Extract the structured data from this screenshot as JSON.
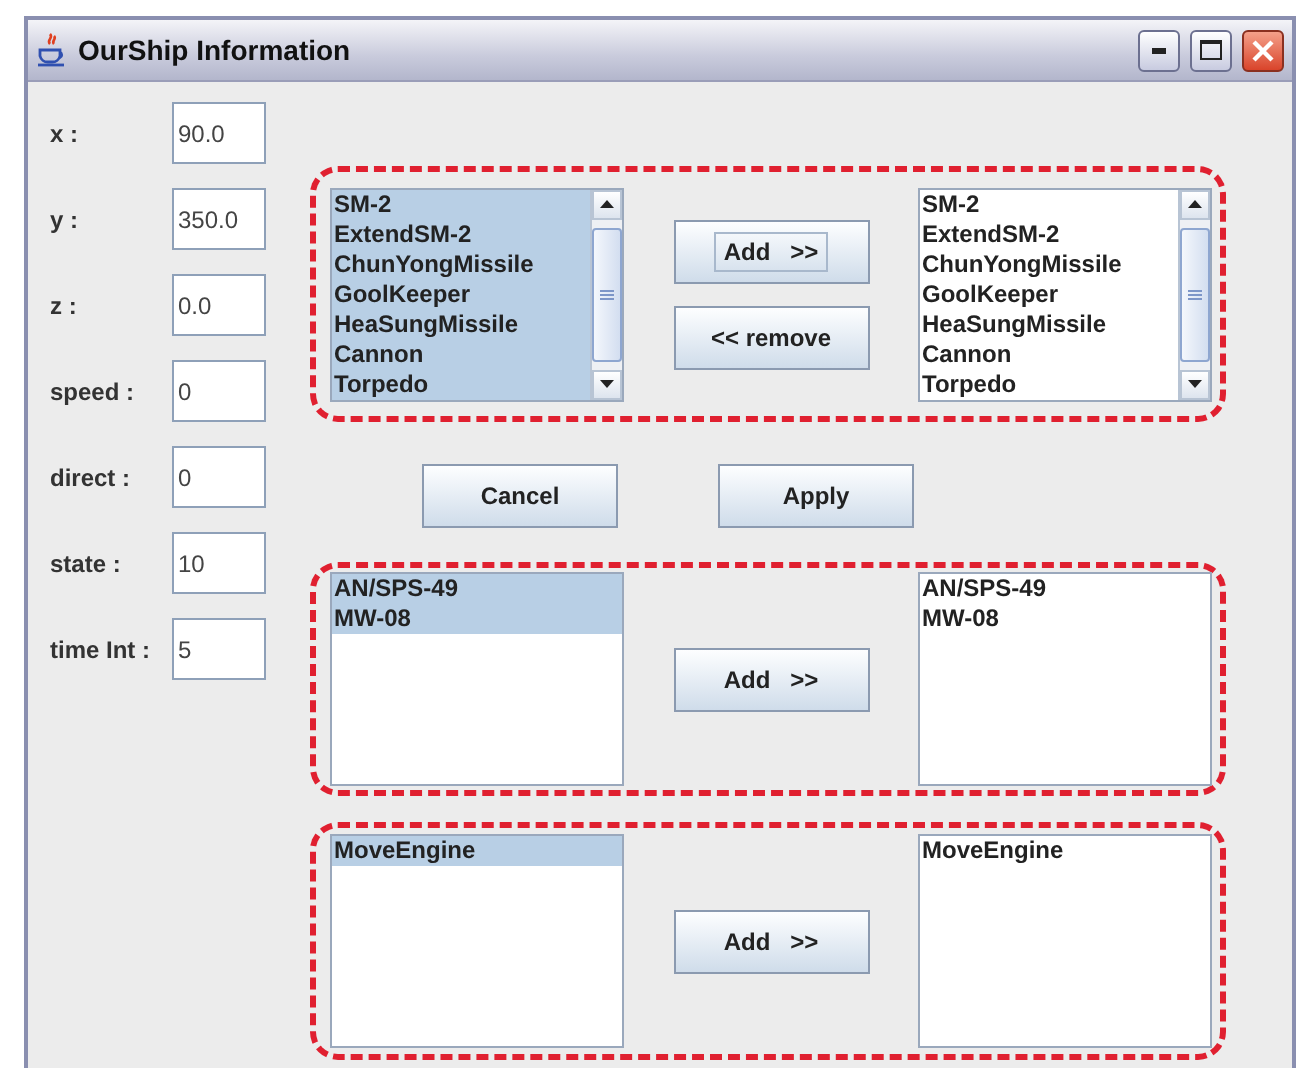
{
  "window": {
    "title": "OurShip Information"
  },
  "fields": [
    {
      "label": "x :",
      "value": "90.0"
    },
    {
      "label": "y :",
      "value": "350.0"
    },
    {
      "label": "z :",
      "value": "0.0"
    },
    {
      "label": "speed :",
      "value": "0"
    },
    {
      "label": "direct :",
      "value": "0"
    },
    {
      "label": "state :",
      "value": "10"
    },
    {
      "label": "time Int :",
      "value": "5"
    }
  ],
  "panels": [
    {
      "source": {
        "scrollable": true,
        "items": [
          {
            "label": "SM-2",
            "selected": true
          },
          {
            "label": "ExtendSM-2",
            "selected": true
          },
          {
            "label": "ChunYongMissile",
            "selected": true
          },
          {
            "label": "GoolKeeper",
            "selected": true
          },
          {
            "label": "HeaSungMissile",
            "selected": true
          },
          {
            "label": "Cannon",
            "selected": true
          },
          {
            "label": "Torpedo",
            "selected": true
          }
        ]
      },
      "buttons": [
        {
          "label": "Add   >>",
          "focused": true
        },
        {
          "label": "<< remove",
          "focused": false
        }
      ],
      "target": {
        "scrollable": true,
        "items": [
          {
            "label": "SM-2",
            "selected": false
          },
          {
            "label": "ExtendSM-2",
            "selected": false
          },
          {
            "label": "ChunYongMissile",
            "selected": false
          },
          {
            "label": "GoolKeeper",
            "selected": false
          },
          {
            "label": "HeaSungMissile",
            "selected": false
          },
          {
            "label": "Cannon",
            "selected": false
          },
          {
            "label": "Torpedo",
            "selected": false
          }
        ]
      }
    },
    {
      "source": {
        "scrollable": false,
        "items": [
          {
            "label": "AN/SPS-49",
            "selected": true
          },
          {
            "label": "MW-08",
            "selected": true
          }
        ]
      },
      "buttons": [
        {
          "label": "Add   >>",
          "focused": false
        }
      ],
      "target": {
        "scrollable": false,
        "items": [
          {
            "label": "AN/SPS-49",
            "selected": false
          },
          {
            "label": "MW-08",
            "selected": false
          }
        ]
      }
    },
    {
      "source": {
        "scrollable": false,
        "items": [
          {
            "label": "MoveEngine",
            "selected": true
          }
        ]
      },
      "buttons": [
        {
          "label": "Add   >>",
          "focused": false
        }
      ],
      "target": {
        "scrollable": false,
        "items": [
          {
            "label": "MoveEngine",
            "selected": false
          }
        ]
      }
    }
  ],
  "actions": [
    {
      "label": "Cancel"
    },
    {
      "label": "Apply"
    }
  ]
}
